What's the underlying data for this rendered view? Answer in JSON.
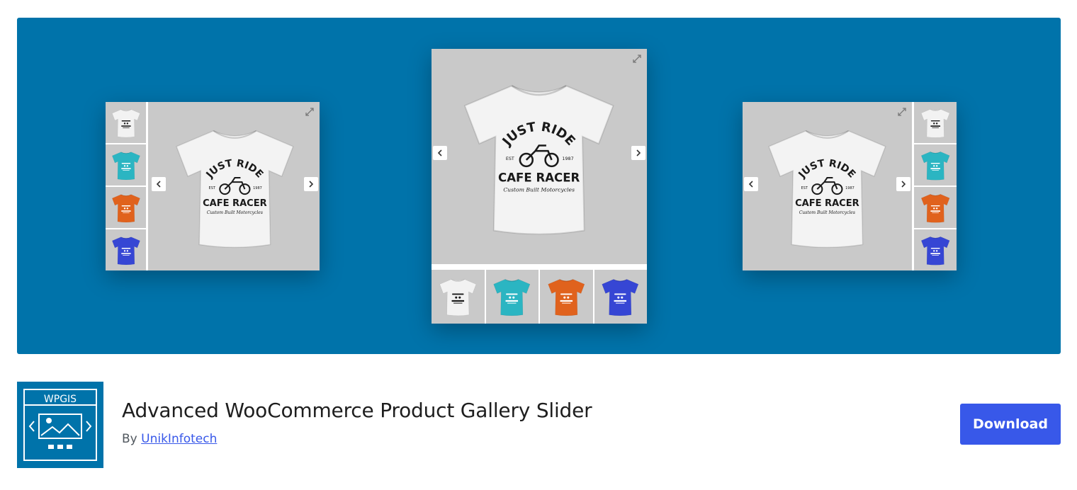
{
  "banner": {
    "background": "#0073aa",
    "shirt_print": {
      "line1": "JUST RIDE",
      "est_left": "EST",
      "est_right": "1987",
      "line2": "CAFE RACER",
      "line3": "Custom Built Motorcycles"
    },
    "thumb_colors": [
      "#f2f2f2",
      "#2bb5c2",
      "#e0621d",
      "#3646d4"
    ]
  },
  "plugin": {
    "icon_label": "WPGIS",
    "title": "Advanced WooCommerce Product Gallery Slider",
    "by_prefix": "By",
    "author": "UnikInfotech",
    "download_label": "Download",
    "accent": "#3858e9"
  }
}
